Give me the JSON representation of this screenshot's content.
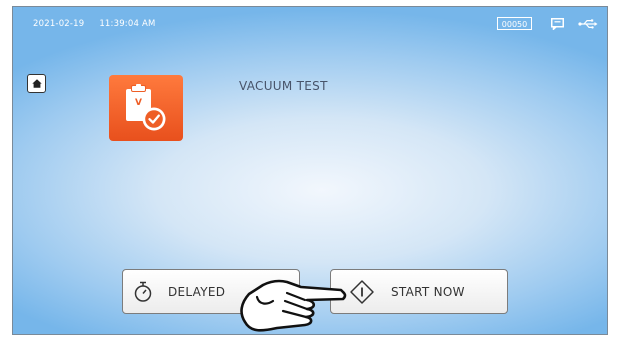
{
  "status_bar": {
    "date": "2021-02-19",
    "time": "11:39:04 AM",
    "counter": "00050",
    "icons": [
      "message-icon",
      "usb-icon"
    ]
  },
  "navigation": {
    "home_icon": "home-icon"
  },
  "program": {
    "title": "VACUUM TEST",
    "icon": "clipboard-check-icon",
    "icon_letter": "V",
    "icon_color": "#f26a30"
  },
  "actions": {
    "delayed_label": "DELAYED",
    "delayed_icon": "stopwatch-icon",
    "start_label": "START NOW",
    "start_icon": "start-diamond-icon"
  },
  "overlay": {
    "pointer_icon": "pointing-hand-icon"
  }
}
